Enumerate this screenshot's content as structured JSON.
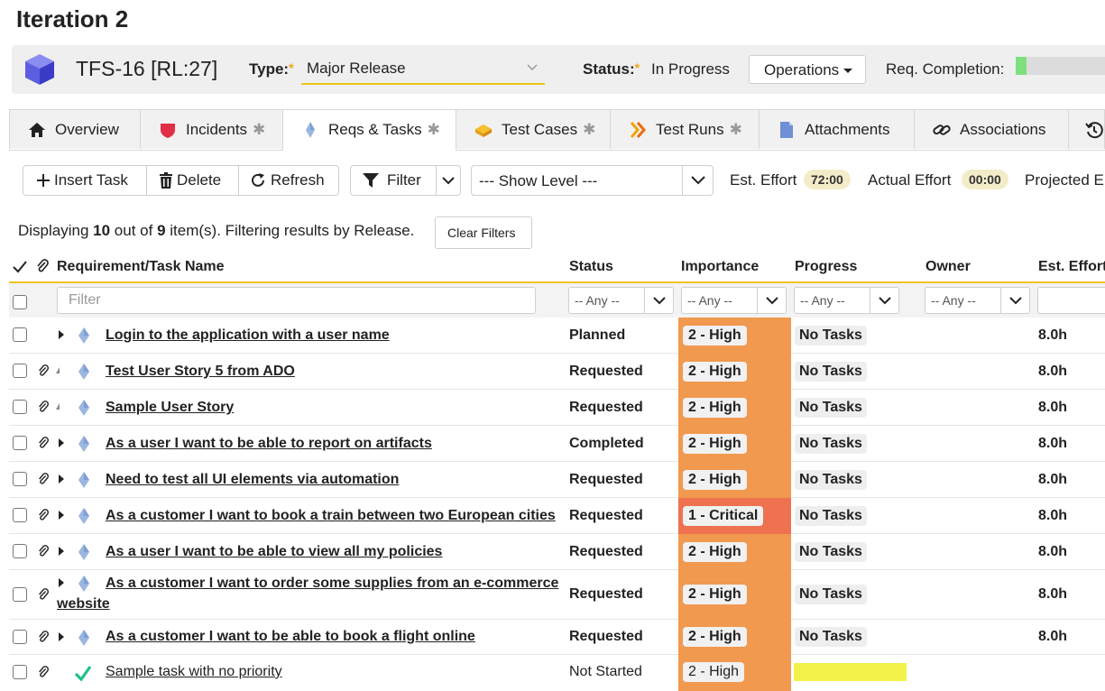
{
  "page": {
    "title": "Iteration 2"
  },
  "release": {
    "id": "TFS-16 [RL:27]",
    "type_label": "Type:",
    "type_value": "Major Release",
    "status_label": "Status:",
    "status_value": "In Progress",
    "operations_label": "Operations",
    "req_completion_label": "Req. Completion:",
    "req_completion_fraction": 0.12
  },
  "tabs": [
    {
      "label": "Overview",
      "icon": "home-icon",
      "starred": false,
      "active": false
    },
    {
      "label": "Incidents",
      "icon": "incident-shield-icon",
      "starred": true,
      "active": false
    },
    {
      "label": "Reqs & Tasks",
      "icon": "requirement-diamond-icon",
      "starred": true,
      "active": true
    },
    {
      "label": "Test Cases",
      "icon": "test-case-icon",
      "starred": true,
      "active": false
    },
    {
      "label": "Test Runs",
      "icon": "test-run-chevrons-icon",
      "starred": true,
      "active": false
    },
    {
      "label": "Attachments",
      "icon": "document-icon",
      "starred": false,
      "active": false
    },
    {
      "label": "Associations",
      "icon": "link-icon",
      "starred": false,
      "active": false
    }
  ],
  "tab_star": "✱",
  "toolbar": {
    "insert_task": "Insert Task",
    "delete": "Delete",
    "refresh": "Refresh",
    "filter": "Filter",
    "show_level": "--- Show Level ---",
    "est_effort_label": "Est. Effort",
    "est_effort_value": "72:00",
    "actual_effort_label": "Actual Effort",
    "actual_effort_value": "00:00",
    "projected_label": "Projected E"
  },
  "display": {
    "prefix": "Displaying ",
    "shown": "10",
    "middle": " out of ",
    "total": "9",
    "suffix": " item(s). Filtering results by Release.",
    "clear_filters": "Clear Filters"
  },
  "grid": {
    "headers": {
      "name": "Requirement/Task Name",
      "status": "Status",
      "importance": "Importance",
      "progress": "Progress",
      "owner": "Owner",
      "est_effort": "Est. Effort"
    },
    "name_filter_placeholder": "Filter",
    "any_option": "-- Any --",
    "rows": [
      {
        "name": "Login to the application with a user name",
        "status": "Planned",
        "importance": "2 - High",
        "progress": "No Tasks",
        "effort": "8.0h"
      },
      {
        "name": "Test User Story 5 from ADO",
        "status": "Requested",
        "importance": "2 - High",
        "progress": "No Tasks",
        "effort": "8.0h"
      },
      {
        "name": "Sample User Story",
        "status": "Requested",
        "importance": "2 - High",
        "progress": "No Tasks",
        "effort": "8.0h"
      },
      {
        "name": "As a user I want to be able to report on artifacts",
        "status": "Completed",
        "importance": "2 - High",
        "progress": "No Tasks",
        "effort": "8.0h"
      },
      {
        "name": "Need to test all UI elements via automation",
        "status": "Requested",
        "importance": "2 - High",
        "progress": "No Tasks",
        "effort": "8.0h"
      },
      {
        "name": "As a customer I want to book a train between two European cities",
        "status": "Requested",
        "importance": "1 - Critical",
        "progress": "No Tasks",
        "effort": "8.0h"
      },
      {
        "name": "As a user I want to be able to view all my policies",
        "status": "Requested",
        "importance": "2 - High",
        "progress": "No Tasks",
        "effort": "8.0h"
      },
      {
        "name_line1": "As a customer I want to order some supplies from an e-commerce",
        "name_line2": "website",
        "status": "Requested",
        "importance": "2 - High",
        "progress": "No Tasks",
        "effort": "8.0h"
      },
      {
        "name": "As a customer I want to be able to book a flight online",
        "status": "Requested",
        "importance": "2 - High",
        "progress": "No Tasks",
        "effort": "8.0h"
      },
      {
        "name": "Sample task with no priority",
        "status": "Not Started",
        "importance": "2 - High",
        "progress_fraction": 0.0,
        "effort": ""
      }
    ]
  },
  "colors": {
    "importance_high": "#f0994f",
    "importance_critical": "#ef7150",
    "accent_yellow": "#f0c419",
    "progress_pending": "#f2f24a"
  }
}
